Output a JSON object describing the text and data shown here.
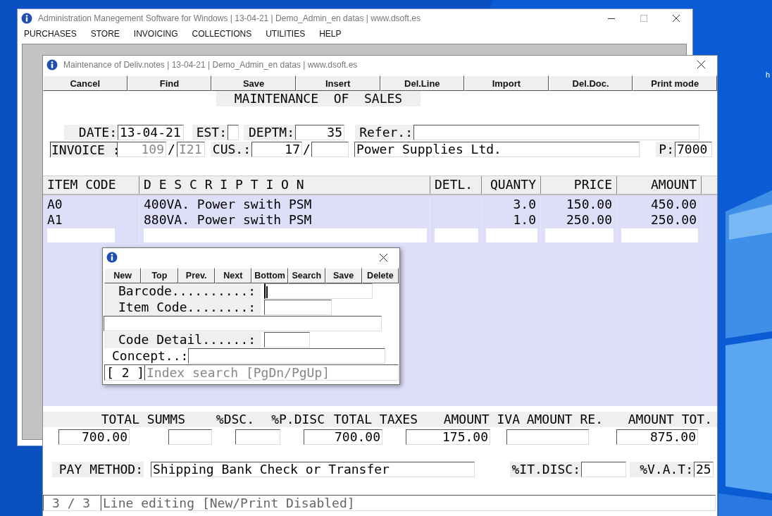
{
  "desktop": {
    "icon_label": "h"
  },
  "main_window": {
    "title": "Administration Manegement Software for Windows | 13-04-21 | Demo_Admin_en datas | www.dsoft.es",
    "menu": [
      "PURCHASES",
      "STORE",
      "INVOICING",
      "COLLECTIONS",
      "UTILITIES",
      "HELP"
    ]
  },
  "form_window": {
    "title": "Maintenance of Deliv.notes | 13-04-21 | Demo_Admin_en datas | www.dsoft.es",
    "toolbar": [
      "Cancel",
      "Find",
      "Save",
      "Insert",
      "Del.Line",
      "Import",
      "Del.Doc.",
      "Print mode"
    ],
    "heading": "MAINTENANCE  OF  SALES",
    "header": {
      "date_label": "DATE:",
      "date": "13-04-21",
      "est_label": "EST:",
      "deptm_label": "DEPTM:",
      "deptm": "35",
      "refer_label": "Refer.:",
      "invoice_label": "INVOICE :",
      "invoice_number": "109",
      "invoice_sep": "/",
      "series": "I21",
      "invoice_disabled": true,
      "cus_label": "CUS.:",
      "customer_number": "17",
      "customer_sep": "/",
      "customer_name": "Power Supplies Ltd.",
      "p_label": "P:",
      "p_value": "7000"
    },
    "table": {
      "columns": [
        "ITEM CODE",
        "D E S C R I P T I O N",
        "DETL.",
        "QUANTY",
        "PRICE",
        "AMOUNT"
      ],
      "rows": [
        {
          "item_code": "A0",
          "description": "400VA. Power swith PSM",
          "quantity": "3.0",
          "price": "150.00",
          "amount": "450.00"
        },
        {
          "item_code": "A1",
          "description": "880VA. Power swith PSM",
          "quantity": "1.0",
          "price": "250.00",
          "amount": "250.00"
        }
      ]
    },
    "totals": [
      {
        "label": "TOTAL SUMMS",
        "value": "700.00"
      },
      {
        "label": "%DSC."
      },
      {
        "label": "%P.DISC"
      },
      {
        "label": "TOTAL TAXES",
        "value": "700.00"
      },
      {
        "label": "AMOUNT IVA",
        "value": "175.00"
      },
      {
        "label": "AMOUNT RE."
      },
      {
        "label": "AMOUNT TOT.",
        "value": "875.00"
      }
    ],
    "payment": {
      "pay_method_label": "PAY METHOD:",
      "pay_method": "Shipping Bank Check or Transfer",
      "it_disc_label": "%IT.DISC:",
      "vat_label": "%V.A.T:",
      "vat": "25"
    },
    "status": {
      "position": "3 / 3",
      "message": "Line editing [New/Print Disabled]"
    }
  },
  "dialog": {
    "toolbar": [
      "New",
      "Top",
      "Prev.",
      "Next",
      "Bottom",
      "Search",
      "Save",
      "Delete"
    ],
    "fields": [
      {
        "kind": "labeled",
        "label": "Barcode..........:",
        "focused": true
      },
      {
        "kind": "labeled",
        "label": "Item Code........:",
        "focused": false
      },
      {
        "kind": "blank",
        "focused": false
      },
      {
        "kind": "labeled",
        "label": "Code Detail......:",
        "focused": false
      },
      {
        "kind": "concept",
        "label": "Concept..:",
        "focused": false
      }
    ],
    "status": {
      "index": "[ 2 ]",
      "message": "Index search [PgDn/PgUp]"
    }
  }
}
